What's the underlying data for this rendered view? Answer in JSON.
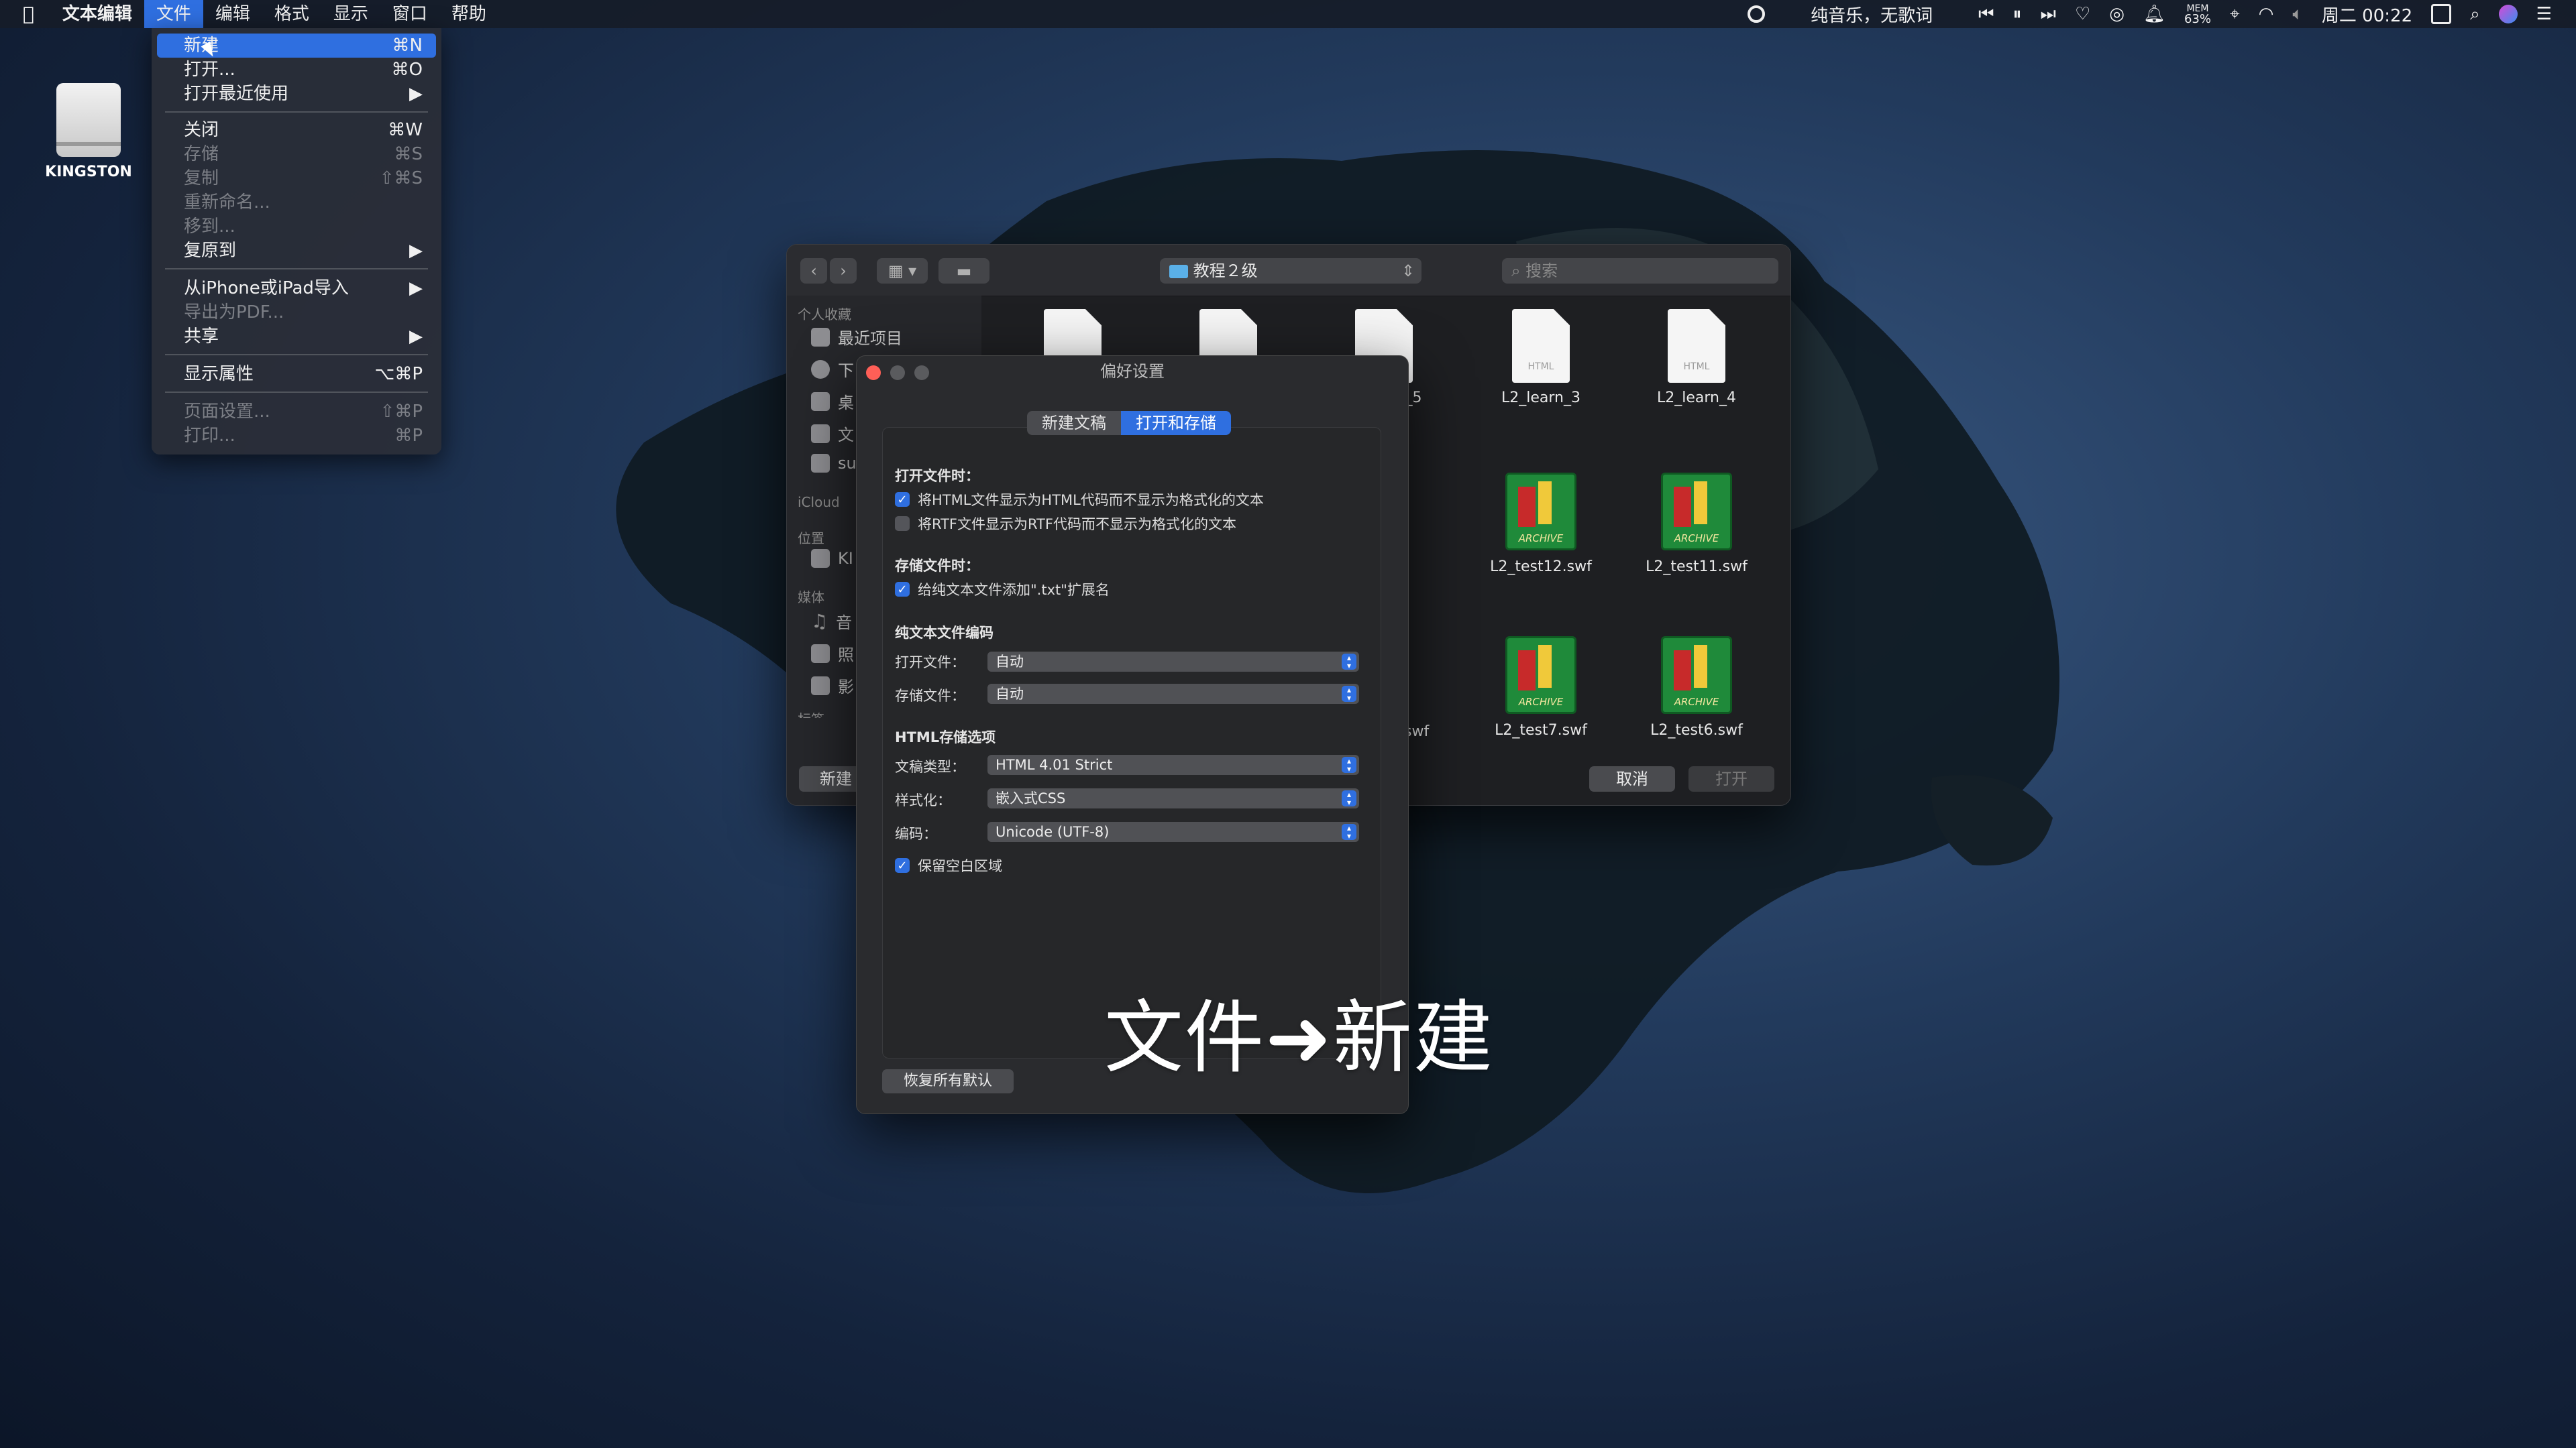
{
  "menubar": {
    "app_name": "文本编辑",
    "menus": [
      "文件",
      "编辑",
      "格式",
      "显示",
      "窗口",
      "帮助"
    ],
    "now_playing": "纯音乐，无歌词",
    "mem_label": "MEM",
    "mem_value": "63%",
    "clock": "周二 00:22"
  },
  "file_menu": {
    "items": [
      {
        "label": "新建",
        "shortcut": "⌘N"
      },
      {
        "label": "打开...",
        "shortcut": "⌘O"
      },
      {
        "label": "打开最近使用",
        "shortcut": "▶"
      },
      {
        "label": "关闭",
        "shortcut": "⌘W"
      },
      {
        "label": "存储",
        "shortcut": "⌘S"
      },
      {
        "label": "复制",
        "shortcut": "⇧⌘S"
      },
      {
        "label": "重新命名...",
        "shortcut": ""
      },
      {
        "label": "移到...",
        "shortcut": ""
      },
      {
        "label": "复原到",
        "shortcut": "▶"
      },
      {
        "label": "从iPhone或iPad导入",
        "shortcut": "▶"
      },
      {
        "label": "导出为PDF...",
        "shortcut": ""
      },
      {
        "label": "共享",
        "shortcut": "▶"
      },
      {
        "label": "显示属性",
        "shortcut": "⌥⌘P"
      },
      {
        "label": "页面设置...",
        "shortcut": "⇧⌘P"
      },
      {
        "label": "打印...",
        "shortcut": "⌘P"
      }
    ]
  },
  "desktop": {
    "disk_label": "KINGSTON"
  },
  "finder": {
    "location": "教程２级",
    "search_placeholder": "搜索",
    "sidebar": {
      "favorites_header": "个人收藏",
      "recents": "最近项目",
      "downloads": "下",
      "desktop": "桌",
      "documents": "文",
      "home": "su",
      "icloud_header": "iCloud",
      "locations_header": "位置",
      "kingston": "KI",
      "media_header": "媒体",
      "music": "音",
      "photos": "照",
      "movies": "影",
      "tags_header": "标签"
    },
    "doc_tag": "HTML",
    "archive_tag": "ARCHIVE",
    "files": {
      "f1": "L2_learn_3",
      "f2": "L2_learn_4",
      "f3": "L2_test12.swf",
      "f4": "L2_test11.swf",
      "f5": "L2_test7.swf",
      "f6": "L2_test6.swf",
      "partial1": "_5",
      "partial2": "swf"
    },
    "new_folder_button": "新建",
    "cancel_button": "取消",
    "open_button": "打开"
  },
  "prefs": {
    "title": "偏好设置",
    "tab_new": "新建文稿",
    "tab_open_save": "打开和存储",
    "open_header": "打开文件时：",
    "cb_html": "将HTML文件显示为HTML代码而不显示为格式化的文本",
    "cb_rtf": "将RTF文件显示为RTF代码而不显示为格式化的文本",
    "save_header": "存储文件时：",
    "cb_txt": "给纯文本文件添加\".txt\"扩展名",
    "enc_header": "纯文本文件编码",
    "open_file_label": "打开文件：",
    "open_file_value": "自动",
    "save_file_label": "存储文件：",
    "save_file_value": "自动",
    "html_header": "HTML存储选项",
    "doc_type_label": "文稿类型：",
    "doc_type_value": "HTML 4.01 Strict",
    "style_label": "样式化：",
    "style_value": "嵌入式CSS",
    "encoding_label": "编码：",
    "encoding_value": "Unicode (UTF-8)",
    "cb_whitespace": "保留空白区域",
    "restore_button": "恢复所有默认"
  },
  "caption": "文件➜新建",
  "colors": {
    "accent": "#2f6fe0",
    "close": "#ff5f57"
  }
}
